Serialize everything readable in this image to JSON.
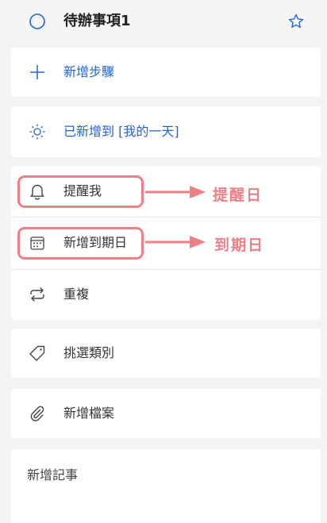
{
  "task": {
    "title": "待辦事項1",
    "complete_icon": "circle-icon",
    "important_icon": "star-icon"
  },
  "steps": {
    "add_step_label": "新增步驟",
    "icon": "plus-icon"
  },
  "my_day": {
    "label": "已新增到 [我的一天]",
    "icon": "sun-icon"
  },
  "schedule": {
    "remind_label": "提醒我",
    "remind_icon": "bell-icon",
    "due_label": "新增到期日",
    "due_icon": "calendar-icon",
    "repeat_label": "重複",
    "repeat_icon": "repeat-icon"
  },
  "category": {
    "label": "挑選類別",
    "icon": "tag-icon"
  },
  "attachment": {
    "label": "新增檔案",
    "icon": "paperclip-icon"
  },
  "note": {
    "placeholder": "新增記事"
  },
  "annotations": {
    "remind_callout": "提醒日",
    "due_callout": "到期日",
    "highlight_color": "#ef7f87"
  },
  "colors": {
    "accent": "#2564cf",
    "text": "#333333",
    "background": "#f4f4f4"
  }
}
